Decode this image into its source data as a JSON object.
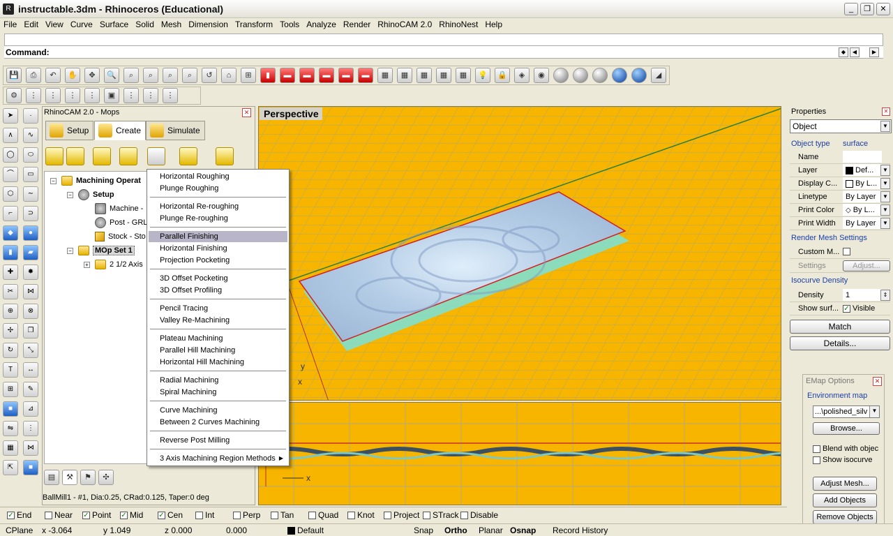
{
  "window": {
    "title": "instructable.3dm - Rhinoceros (Educational)"
  },
  "menu": [
    "File",
    "Edit",
    "View",
    "Curve",
    "Surface",
    "Solid",
    "Mesh",
    "Dimension",
    "Transform",
    "Tools",
    "Analyze",
    "Render",
    "RhinoCAM 2.0",
    "RhinoNest",
    "Help"
  ],
  "command": {
    "label": "Command:"
  },
  "rhinocam": {
    "panel_title": "RhinoCAM 2.0 - Mops",
    "tabs": [
      "Setup",
      "Create",
      "Simulate"
    ],
    "tree": {
      "root": "Machining Operat",
      "setup": "Setup",
      "machine": "Machine -",
      "post": "Post - GRL",
      "stock": "Stock - Sto",
      "mopset": "MOp Set 1",
      "axis": "2 1/2 Axis"
    },
    "status": "BallMill1 - #1, Dia:0.25, CRad:0.125, Taper:0 deg"
  },
  "popup_menu": {
    "items": [
      "Horizontal Roughing",
      "Plunge Roughing",
      "Horizontal Re-roughing",
      "Plunge Re-roughing",
      "Parallel Finishing",
      "Horizontal Finishing",
      "Projection Pocketing",
      "3D Offset Pocketing",
      "3D Offset Profiling",
      "Pencil Tracing",
      "Valley Re-Machining",
      "Plateau Machining",
      "Parallel Hill Machining",
      "Horizontal Hill Machining",
      "Radial Machining",
      "Spiral Machining",
      "Curve Machining",
      "Between 2 Curves Machining",
      "Reverse Post Milling",
      "3 Axis Machining Region Methods"
    ],
    "selected": "Parallel Finishing"
  },
  "viewport": {
    "title": "Perspective",
    "axis_y": "y",
    "axis_x": "x",
    "axis_x2": "x"
  },
  "properties": {
    "title": "Properties",
    "selector": "Object",
    "object_type_label": "Object type",
    "object_type_value": "surface",
    "rows": [
      {
        "key": "Name",
        "value": ""
      },
      {
        "key": "Layer",
        "value": "Def..."
      },
      {
        "key": "Display C...",
        "value": "By L..."
      },
      {
        "key": "Linetype",
        "value": "By Layer"
      },
      {
        "key": "Print Color",
        "value": "By L..."
      },
      {
        "key": "Print Width",
        "value": "By Layer"
      }
    ],
    "render_mesh_label": "Render Mesh Settings",
    "custom_mesh_label": "Custom M...",
    "settings_label": "Settings",
    "adjust_label": "Adjust...",
    "isocurve_label": "Isocurve Density",
    "density_label": "Density",
    "density_value": "1",
    "show_surf_label": "Show surf...",
    "visible_label": "Visible",
    "match_label": "Match",
    "details_label": "Details..."
  },
  "emap": {
    "title": "EMap Options",
    "env_label": "Environment map",
    "env_value": "...\\polished_silv",
    "browse": "Browse...",
    "blend": "Blend with objec",
    "show_iso": "Show isocurve",
    "adjust_mesh": "Adjust Mesh...",
    "add_objects": "Add Objects",
    "remove_objects": "Remove Objects"
  },
  "osnap": [
    {
      "label": "End",
      "checked": true
    },
    {
      "label": "Near",
      "checked": false
    },
    {
      "label": "Point",
      "checked": true
    },
    {
      "label": "Mid",
      "checked": true
    },
    {
      "label": "Cen",
      "checked": true
    },
    {
      "label": "Int",
      "checked": false
    },
    {
      "label": "Perp",
      "checked": false
    },
    {
      "label": "Tan",
      "checked": false
    },
    {
      "label": "Quad",
      "checked": false
    },
    {
      "label": "Knot",
      "checked": false
    },
    {
      "label": "Project",
      "checked": false
    },
    {
      "label": "STrack",
      "checked": false
    },
    {
      "label": "Disable",
      "checked": false
    }
  ],
  "statusbar": {
    "cplane": "CPlane",
    "x": "x -3.064",
    "y": "y 1.049",
    "z": "z 0.000",
    "dist": "0.000",
    "layer": "Default",
    "snap": "Snap",
    "ortho": "Ortho",
    "planar": "Planar",
    "osnap": "Osnap",
    "history": "Record History"
  }
}
